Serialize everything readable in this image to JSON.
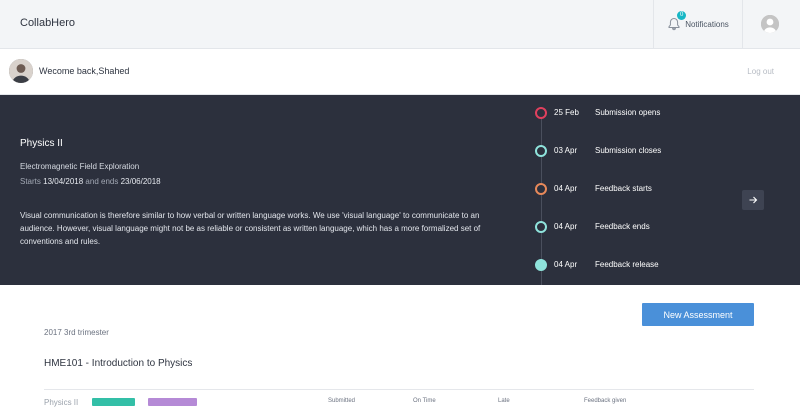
{
  "app": {
    "title": "CollabHero"
  },
  "header": {
    "notifications_label": "Notifications",
    "notifications_count": "0"
  },
  "welcome": {
    "text": "Wecome back,Shahed",
    "logout": "Log out"
  },
  "course": {
    "title": "Physics II",
    "subtitle": "Electromagnetic Field Exploration",
    "starts_word": "Starts",
    "start_date": "13/04/2018",
    "ends_word": "and ends",
    "end_date": "23/06/2018",
    "description": "Visual communication is therefore similar to how verbal or written language works. We use 'visual language' to communicate to an audience. However, visual language might not be as reliable or consistent as written language, which has a more formalized set of conventions and rules."
  },
  "timeline": [
    {
      "date": "25 Feb",
      "label": "Submission opens",
      "color": "#e0405e",
      "filled": false
    },
    {
      "date": "03 Apr",
      "label": "Submission closes",
      "color": "#8fe3dc",
      "filled": false
    },
    {
      "date": "04 Apr",
      "label": "Feedback starts",
      "color": "#e8895a",
      "filled": false
    },
    {
      "date": "04 Apr",
      "label": "Feedback ends",
      "color": "#8fe3dc",
      "filled": false
    },
    {
      "date": "04 Apr",
      "label": "Feedback release",
      "color": "#8fe3dc",
      "filled": true
    }
  ],
  "actions": {
    "new_assessment": "New Assessment"
  },
  "term": "2017 3rd trimester",
  "course_code": "HME101 - Introduction to Physics",
  "assessment_row": {
    "name": "Physics II",
    "columns": [
      "Submitted",
      "On Time",
      "Late",
      "Feedback given"
    ]
  },
  "colors": {
    "accent": "#4a90d9",
    "dark_panel": "#2c303d",
    "tag_green": "#33bfa7",
    "tag_purple": "#b58ad6"
  },
  "icons": {
    "notifications": "bell-icon",
    "next": "arrow-right-icon",
    "avatar": "user-avatar-icon"
  }
}
